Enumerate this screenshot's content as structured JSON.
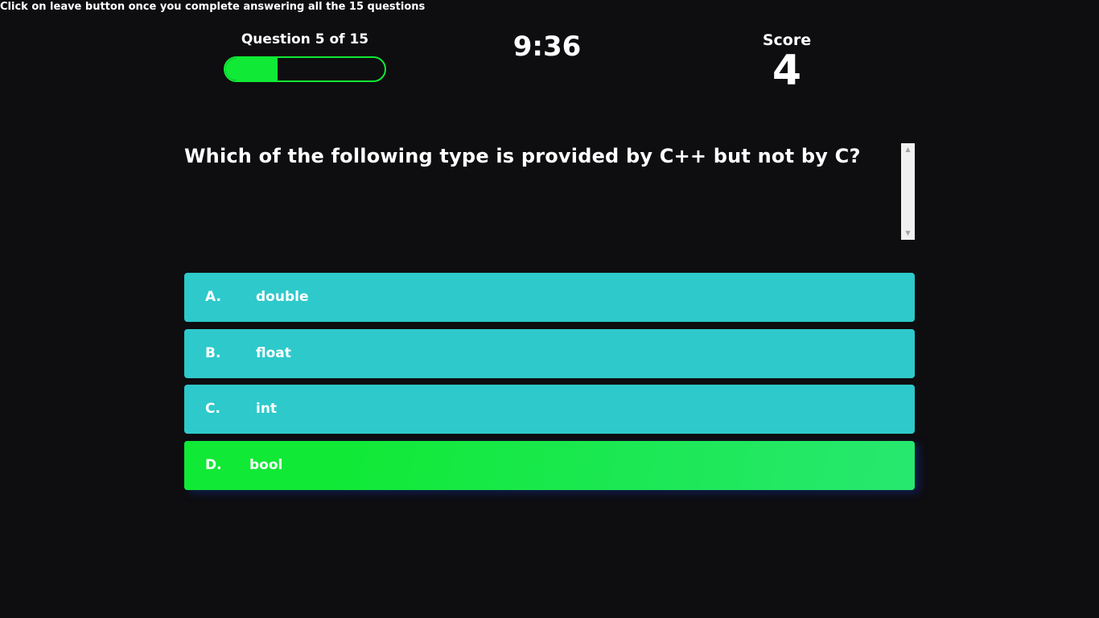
{
  "instruction": "Click on leave button once you complete answering all the 15 questions",
  "progress": {
    "label": "Question 5 of 15",
    "current": 5,
    "total": 15,
    "fill_fraction": 0.33,
    "color": "#10e935"
  },
  "timer": "9:36",
  "score": {
    "label": "Score",
    "value": "4"
  },
  "question": {
    "text": "Which of the following type is provided by C++ but not by C?"
  },
  "options": [
    {
      "letter": "A.",
      "text": "double",
      "selected": false
    },
    {
      "letter": "B.",
      "text": "float",
      "selected": false
    },
    {
      "letter": "C.",
      "text": "int",
      "selected": false
    },
    {
      "letter": "D.",
      "text": "bool",
      "selected": true
    }
  ],
  "colors": {
    "background": "#0e0d10",
    "option": "#2ec9cb",
    "selected": "#10e935",
    "text": "#ffffff"
  }
}
